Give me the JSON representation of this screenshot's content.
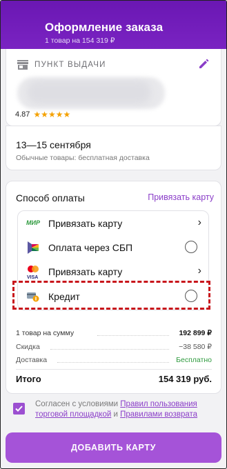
{
  "header": {
    "title": "Оформление заказа",
    "subtitle": "1 товар на 154 319 ₽"
  },
  "pickup": {
    "label": "ПУНКТ ВЫДАЧИ",
    "rating": "4.87",
    "stars": "★★★★★"
  },
  "delivery": {
    "dates": "13—15 сентября",
    "note": "Обычные товары: бесплатная доставка"
  },
  "payment": {
    "title": "Способ оплаты",
    "link": "Привязать карту",
    "methods": [
      {
        "label": "Привязать карту",
        "icon": "mir-icon",
        "mir_text": "МИР"
      },
      {
        "label": "Оплата через СБП",
        "icon": "sbp-icon"
      },
      {
        "label": "Привязать карту",
        "icon": "mastercard-visa-icon",
        "visa_text": "VISA"
      },
      {
        "label": "Кредит",
        "icon": "credit-icon"
      }
    ]
  },
  "summary": {
    "rows": [
      {
        "label": "1 товар на сумму",
        "value": "192 899 ₽"
      },
      {
        "label": "Скидка",
        "value": "−38 580 ₽"
      },
      {
        "label": "Доставка",
        "value": "Бесплатно"
      }
    ],
    "total_label": "Итого",
    "total_value": "154 319 руб."
  },
  "agreement": {
    "prefix": "Согласен с условиями ",
    "link1": "Правил пользования торговой площадкой",
    "middle": " и ",
    "link2": "Правилами возврата"
  },
  "cta": "ДОБАВИТЬ КАРТУ",
  "colors": {
    "brand": "#6a17b3",
    "accent": "#8a3dc8",
    "button": "#a553d8",
    "highlight": "#c8151b",
    "success": "#2e9a3e"
  }
}
